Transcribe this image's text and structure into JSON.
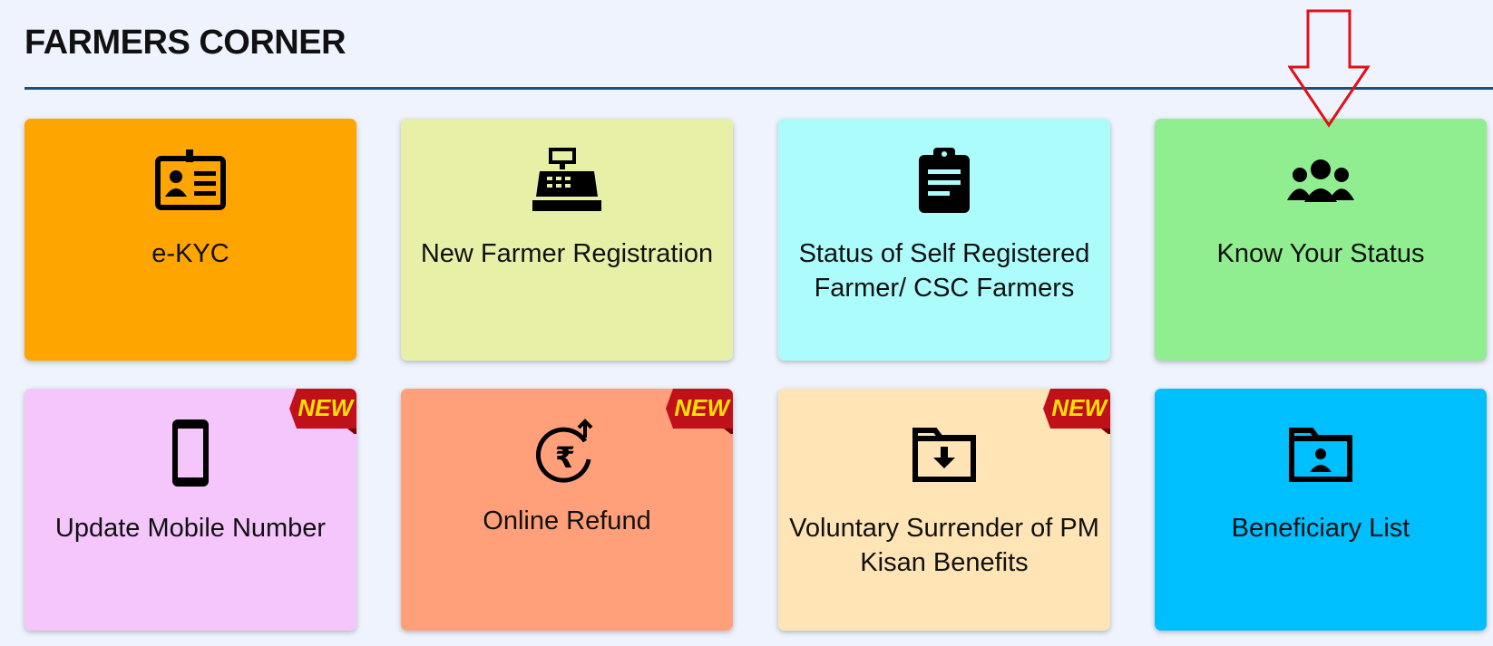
{
  "section": {
    "title": "FARMERS CORNER"
  },
  "badges": {
    "new_label": "NEW"
  },
  "cards": [
    {
      "label": "e-KYC",
      "icon": "id-card-icon",
      "bg": "#ffa500"
    },
    {
      "label": "New Farmer Registration",
      "icon": "cash-register-icon",
      "bg": "#e8f0a8"
    },
    {
      "label": "Status of Self Registered Farmer/ CSC Farmers",
      "icon": "clipboard-list-icon",
      "bg": "#adfcfc"
    },
    {
      "label": "Know Your Status",
      "icon": "users-group-icon",
      "bg": "#90ee90"
    },
    {
      "label": "Update Mobile Number",
      "icon": "mobile-phone-icon",
      "bg": "#f5c6fc",
      "badge": "NEW"
    },
    {
      "label": "Online Refund",
      "icon": "rupee-refund-icon",
      "bg": "#ffa07a",
      "badge": "NEW"
    },
    {
      "label": "Voluntary Surrender of PM Kisan Benefits",
      "icon": "folder-download-icon",
      "bg": "#ffe4b5",
      "badge": "NEW"
    },
    {
      "label": "Beneficiary List",
      "icon": "folder-user-icon",
      "bg": "#00bfff"
    }
  ],
  "colors": {
    "page_bg": "#eef3fd",
    "rule": "#1f4e79",
    "arrow": "#e0101a",
    "badge_bg": "#c0101a",
    "badge_text": "#ffe100"
  }
}
